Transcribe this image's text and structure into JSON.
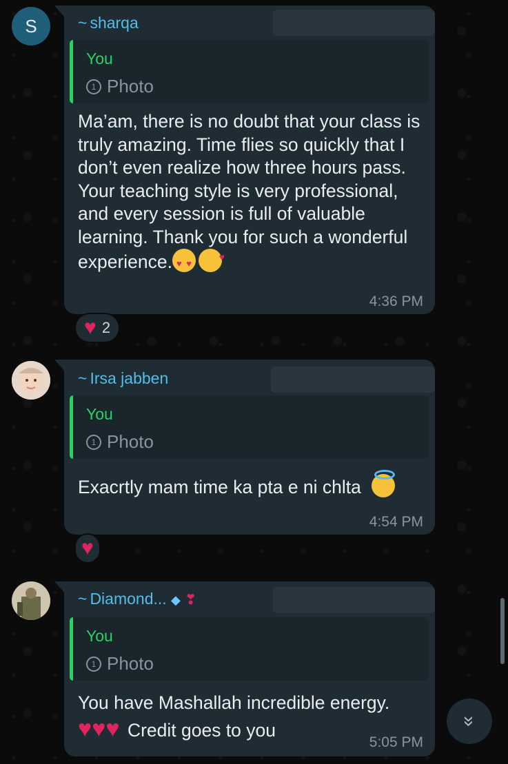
{
  "messages": [
    {
      "sender": "sharqa",
      "avatar_letter": "S",
      "quoted_author": "You",
      "quoted_type": "Photo",
      "text": "Ma’am, there is no doubt that your class is truly amazing. Time flies so quickly that I don’t even realize how three hours pass. Your teaching style is very professional, and every session is full of valuable learning. Thank you for such a wonderful experience.",
      "emoji": [
        "smiling-face-with-heart-eyes",
        "smiling-face-with-hearts"
      ],
      "time": "4:36 PM",
      "reaction": {
        "emoji": "red-heart",
        "count": "2"
      }
    },
    {
      "sender": "Irsa jabben",
      "avatar_letter": "",
      "quoted_author": "You",
      "quoted_type": "Photo",
      "text": "Exacrtly mam time ka pta e ni chlta",
      "emoji": [
        "smiling-face-with-halo"
      ],
      "time": "4:54 PM",
      "reaction": {
        "emoji": "red-heart",
        "count": ""
      }
    },
    {
      "sender": "Diamond...",
      "avatar_letter": "",
      "quoted_author": "You",
      "quoted_type": "Photo",
      "text": "You have Mashallah incredible energy.",
      "text_line2": "Credit goes to you",
      "emoji": [
        "red-heart",
        "red-heart",
        "red-heart"
      ],
      "time": "5:05 PM"
    }
  ],
  "colors": {
    "background": "#0b0b0b",
    "bubble": "#1f2c34",
    "sender_name": "#53bdeb",
    "quote_accent": "#25d366",
    "text": "#e9edef",
    "meta": "#8696a0",
    "heart": "#e0245e"
  },
  "icons": {
    "scroll_down": "double-chevron-down-icon",
    "photo": "view-once-photo-icon"
  }
}
